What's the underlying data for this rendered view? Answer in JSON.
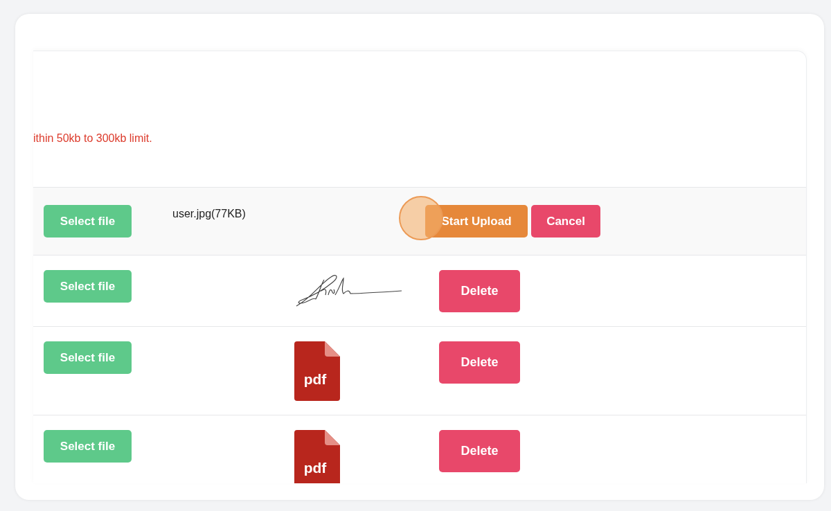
{
  "notice": "ithin 50kb to 300kb limit.",
  "rows": [
    {
      "kind": "pending",
      "select_label": "Select file",
      "file_name": "user.jpg(77KB)",
      "buttons": [
        {
          "label": "Start Upload",
          "kind": "upload",
          "highlighted": true
        },
        {
          "label": "Cancel",
          "kind": "cancel",
          "highlighted": false
        }
      ]
    },
    {
      "kind": "uploaded",
      "select_label": "Select file",
      "preview": {
        "kind": "signature"
      },
      "buttons": [
        {
          "label": "Delete",
          "kind": "delete",
          "highlighted": false
        }
      ]
    },
    {
      "kind": "uploaded",
      "select_label": "Select file",
      "preview": {
        "kind": "pdf",
        "label": "pdf"
      },
      "buttons": [
        {
          "label": "Delete",
          "kind": "delete",
          "highlighted": false
        }
      ]
    },
    {
      "kind": "uploaded",
      "select_label": "Select file",
      "preview": {
        "kind": "pdf",
        "label": "pdf"
      },
      "buttons": [
        {
          "label": "Delete",
          "kind": "delete",
          "highlighted": false
        }
      ]
    }
  ]
}
